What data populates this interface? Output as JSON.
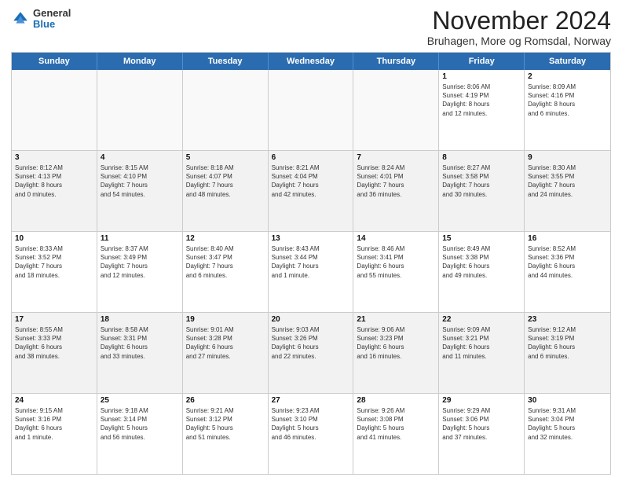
{
  "header": {
    "logo": {
      "general": "General",
      "blue": "Blue"
    },
    "title": "November 2024",
    "location": "Bruhagen, More og Romsdal, Norway"
  },
  "weekdays": [
    "Sunday",
    "Monday",
    "Tuesday",
    "Wednesday",
    "Thursday",
    "Friday",
    "Saturday"
  ],
  "rows": [
    {
      "cells": [
        {
          "day": null,
          "info": null
        },
        {
          "day": null,
          "info": null
        },
        {
          "day": null,
          "info": null
        },
        {
          "day": null,
          "info": null
        },
        {
          "day": null,
          "info": null
        },
        {
          "day": "1",
          "info": "Sunrise: 8:06 AM\nSunset: 4:19 PM\nDaylight: 8 hours\nand 12 minutes."
        },
        {
          "day": "2",
          "info": "Sunrise: 8:09 AM\nSunset: 4:16 PM\nDaylight: 8 hours\nand 6 minutes."
        }
      ]
    },
    {
      "cells": [
        {
          "day": "3",
          "info": "Sunrise: 8:12 AM\nSunset: 4:13 PM\nDaylight: 8 hours\nand 0 minutes."
        },
        {
          "day": "4",
          "info": "Sunrise: 8:15 AM\nSunset: 4:10 PM\nDaylight: 7 hours\nand 54 minutes."
        },
        {
          "day": "5",
          "info": "Sunrise: 8:18 AM\nSunset: 4:07 PM\nDaylight: 7 hours\nand 48 minutes."
        },
        {
          "day": "6",
          "info": "Sunrise: 8:21 AM\nSunset: 4:04 PM\nDaylight: 7 hours\nand 42 minutes."
        },
        {
          "day": "7",
          "info": "Sunrise: 8:24 AM\nSunset: 4:01 PM\nDaylight: 7 hours\nand 36 minutes."
        },
        {
          "day": "8",
          "info": "Sunrise: 8:27 AM\nSunset: 3:58 PM\nDaylight: 7 hours\nand 30 minutes."
        },
        {
          "day": "9",
          "info": "Sunrise: 8:30 AM\nSunset: 3:55 PM\nDaylight: 7 hours\nand 24 minutes."
        }
      ]
    },
    {
      "cells": [
        {
          "day": "10",
          "info": "Sunrise: 8:33 AM\nSunset: 3:52 PM\nDaylight: 7 hours\nand 18 minutes."
        },
        {
          "day": "11",
          "info": "Sunrise: 8:37 AM\nSunset: 3:49 PM\nDaylight: 7 hours\nand 12 minutes."
        },
        {
          "day": "12",
          "info": "Sunrise: 8:40 AM\nSunset: 3:47 PM\nDaylight: 7 hours\nand 6 minutes."
        },
        {
          "day": "13",
          "info": "Sunrise: 8:43 AM\nSunset: 3:44 PM\nDaylight: 7 hours\nand 1 minute."
        },
        {
          "day": "14",
          "info": "Sunrise: 8:46 AM\nSunset: 3:41 PM\nDaylight: 6 hours\nand 55 minutes."
        },
        {
          "day": "15",
          "info": "Sunrise: 8:49 AM\nSunset: 3:38 PM\nDaylight: 6 hours\nand 49 minutes."
        },
        {
          "day": "16",
          "info": "Sunrise: 8:52 AM\nSunset: 3:36 PM\nDaylight: 6 hours\nand 44 minutes."
        }
      ]
    },
    {
      "cells": [
        {
          "day": "17",
          "info": "Sunrise: 8:55 AM\nSunset: 3:33 PM\nDaylight: 6 hours\nand 38 minutes."
        },
        {
          "day": "18",
          "info": "Sunrise: 8:58 AM\nSunset: 3:31 PM\nDaylight: 6 hours\nand 33 minutes."
        },
        {
          "day": "19",
          "info": "Sunrise: 9:01 AM\nSunset: 3:28 PM\nDaylight: 6 hours\nand 27 minutes."
        },
        {
          "day": "20",
          "info": "Sunrise: 9:03 AM\nSunset: 3:26 PM\nDaylight: 6 hours\nand 22 minutes."
        },
        {
          "day": "21",
          "info": "Sunrise: 9:06 AM\nSunset: 3:23 PM\nDaylight: 6 hours\nand 16 minutes."
        },
        {
          "day": "22",
          "info": "Sunrise: 9:09 AM\nSunset: 3:21 PM\nDaylight: 6 hours\nand 11 minutes."
        },
        {
          "day": "23",
          "info": "Sunrise: 9:12 AM\nSunset: 3:19 PM\nDaylight: 6 hours\nand 6 minutes."
        }
      ]
    },
    {
      "cells": [
        {
          "day": "24",
          "info": "Sunrise: 9:15 AM\nSunset: 3:16 PM\nDaylight: 6 hours\nand 1 minute."
        },
        {
          "day": "25",
          "info": "Sunrise: 9:18 AM\nSunset: 3:14 PM\nDaylight: 5 hours\nand 56 minutes."
        },
        {
          "day": "26",
          "info": "Sunrise: 9:21 AM\nSunset: 3:12 PM\nDaylight: 5 hours\nand 51 minutes."
        },
        {
          "day": "27",
          "info": "Sunrise: 9:23 AM\nSunset: 3:10 PM\nDaylight: 5 hours\nand 46 minutes."
        },
        {
          "day": "28",
          "info": "Sunrise: 9:26 AM\nSunset: 3:08 PM\nDaylight: 5 hours\nand 41 minutes."
        },
        {
          "day": "29",
          "info": "Sunrise: 9:29 AM\nSunset: 3:06 PM\nDaylight: 5 hours\nand 37 minutes."
        },
        {
          "day": "30",
          "info": "Sunrise: 9:31 AM\nSunset: 3:04 PM\nDaylight: 5 hours\nand 32 minutes."
        }
      ]
    }
  ]
}
